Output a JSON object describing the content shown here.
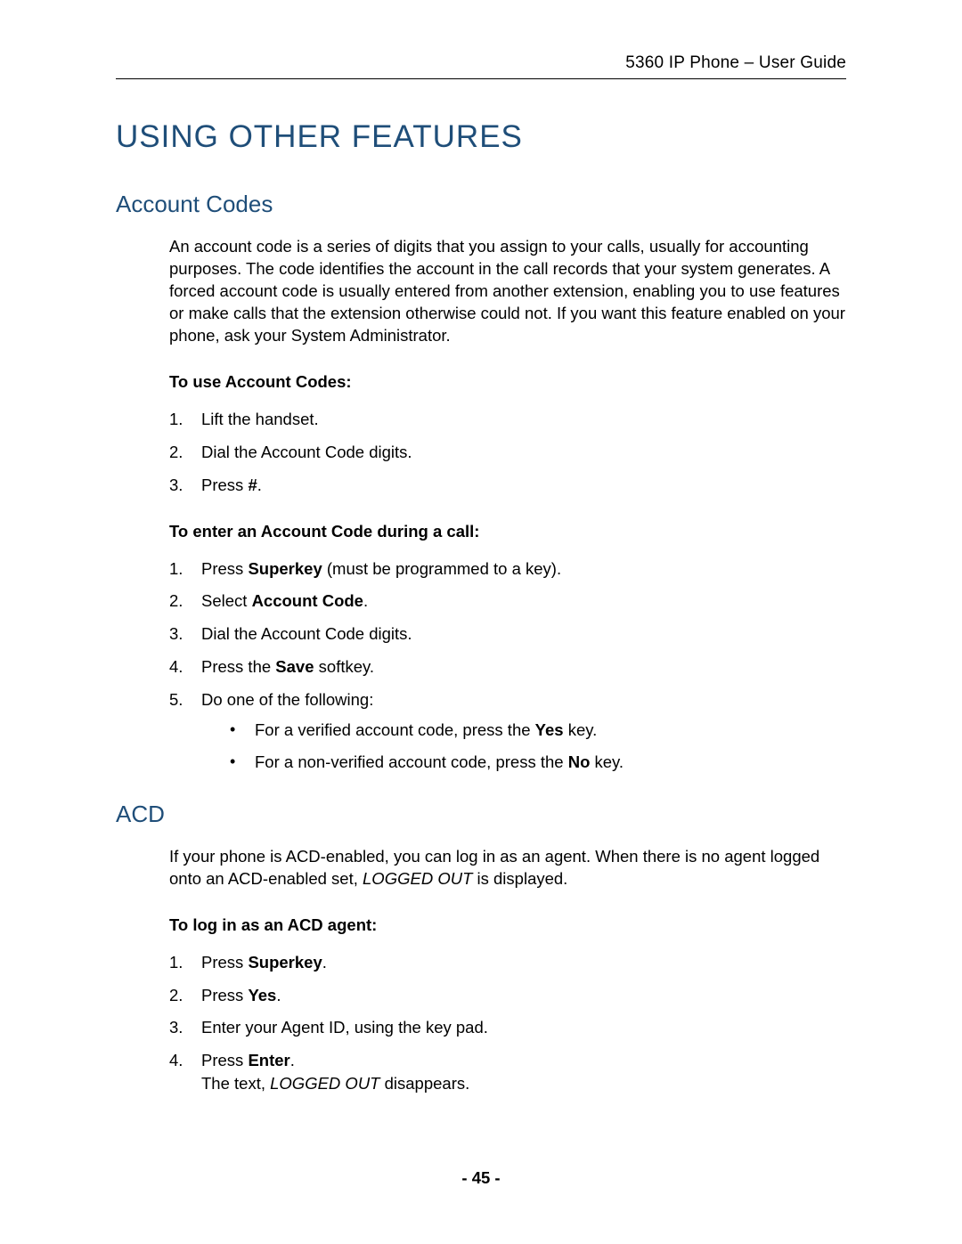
{
  "header": {
    "right": "5360 IP Phone – User Guide"
  },
  "title": "USING OTHER FEATURES",
  "s1": {
    "heading": "Account Codes",
    "para": "An account code is a series of digits that you assign to your calls, usually for accounting purposes. The code identifies the account in the call records that your system generates. A forced account code is usually entered from another extension, enabling you to use features or make calls that the extension otherwise could not. If you want this feature enabled on your phone, ask your System Administrator.",
    "sub1": "To use Account Codes:",
    "l1": {
      "a": "Lift the handset.",
      "b": "Dial the Account Code digits.",
      "c_pre": "Press ",
      "c_b": "#",
      "c_post": "."
    },
    "sub2": "To enter an Account Code during a call:",
    "l2": {
      "a_pre": "Press ",
      "a_b": "Superkey",
      "a_post": " (must be programmed to a key).",
      "b_pre": "Select ",
      "b_b": "Account Code",
      "b_post": ".",
      "c": "Dial the Account Code digits.",
      "d_pre": "Press the ",
      "d_b": "Save",
      "d_post": " softkey.",
      "e": "Do one of the following:",
      "e1_pre": "For a verified account code, press the ",
      "e1_b": "Yes",
      "e1_post": " key.",
      "e2_pre": "For a non-verified account code, press the ",
      "e2_b": "No",
      "e2_post": " key."
    }
  },
  "s2": {
    "heading": "ACD",
    "para_pre": "If your phone is ACD-enabled, you can log in as an agent. When there is no agent logged onto an ACD-enabled set, ",
    "para_i": "LOGGED OUT",
    "para_post": " is displayed.",
    "sub1": "To log in as an ACD agent:",
    "l1": {
      "a_pre": "Press ",
      "a_b": "Superkey",
      "a_post": ".",
      "b_pre": "Press ",
      "b_b": "Yes",
      "b_post": ".",
      "c": "Enter your Agent ID, using the key pad.",
      "d_pre": "Press ",
      "d_b": "Enter",
      "d_post": ".",
      "d2_pre": "The text, ",
      "d2_i": "LOGGED OUT",
      "d2_post": " disappears."
    }
  },
  "footer": "- 45 -",
  "nums": {
    "n1": "1.",
    "n2": "2.",
    "n3": "3.",
    "n4": "4.",
    "n5": "5."
  }
}
